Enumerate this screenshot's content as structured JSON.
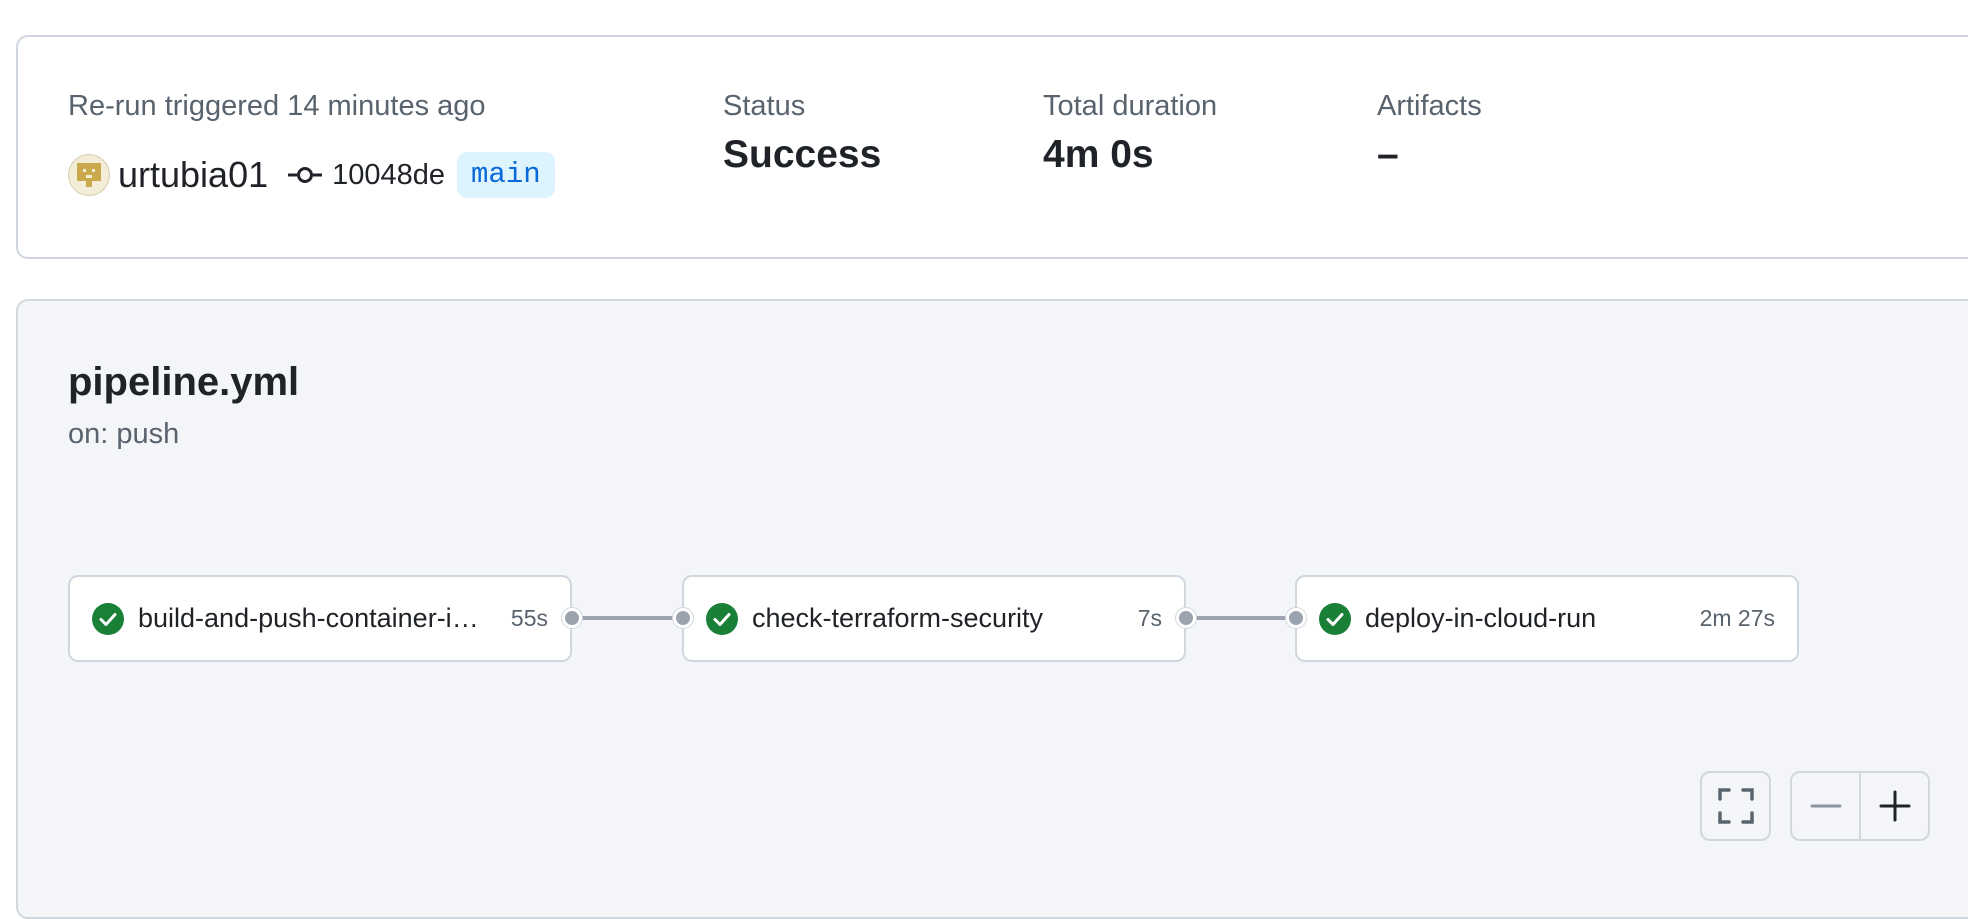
{
  "summary": {
    "trigger_text": "Re-run triggered 14 minutes ago",
    "username": "urtubia01",
    "commit_sha": "10048de",
    "branch": "main",
    "status_label": "Status",
    "status_value": "Success",
    "duration_label": "Total duration",
    "duration_value": "4m 0s",
    "artifacts_label": "Artifacts",
    "artifacts_value": "–"
  },
  "workflow": {
    "file": "pipeline.yml",
    "trigger": "on: push"
  },
  "jobs": [
    {
      "name": "build-and-push-container-image",
      "duration": "55s",
      "status": "success"
    },
    {
      "name": "check-terraform-security",
      "duration": "7s",
      "status": "success"
    },
    {
      "name": "deploy-in-cloud-run",
      "duration": "2m 27s",
      "status": "success"
    }
  ],
  "icons": {
    "avatar": "identicon-avatar",
    "commit": "git-commit-icon",
    "job_status": "check-circle-icon",
    "fullscreen": "fullscreen-icon",
    "zoom_out": "minus-icon",
    "zoom_in": "plus-icon"
  },
  "colors": {
    "success": "#1a7f37",
    "branch_text": "#0969da",
    "branch_bg": "#ddf4ff",
    "panel_bg": "#f3f5f9"
  }
}
